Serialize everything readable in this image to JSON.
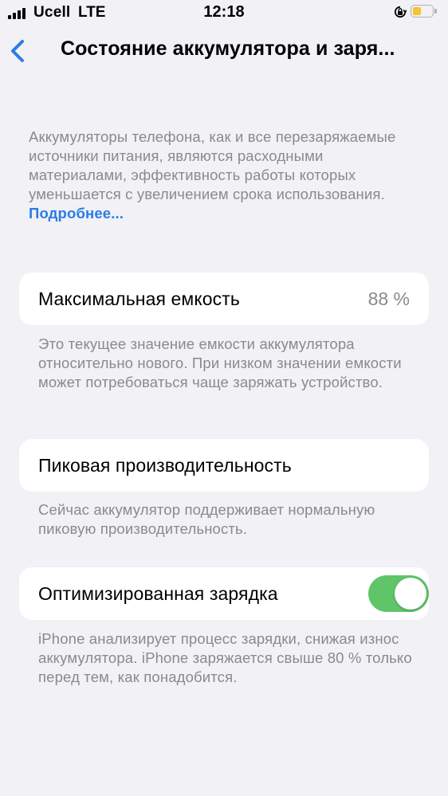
{
  "status_bar": {
    "carrier": "Ucell",
    "network": "LTE",
    "time": "12:18",
    "battery_color": "#f4c531"
  },
  "nav": {
    "back_icon": "chevron-left-icon",
    "title": "Состояние аккумулятора и заря..."
  },
  "intro": {
    "text": "Аккумуляторы телефона, как и все перезаряжаемые источники питания, являются расходными материалами, эффективность работы которых уменьшается с увеличением срока использования.",
    "link": "Подробнее..."
  },
  "max_capacity": {
    "label": "Максимальная емкость",
    "value": "88 %",
    "footnote": "Это текущее значение емкости аккумулятора относительно нового. При низком значении емкости может потребоваться чаще заряжать устройство."
  },
  "peak_performance": {
    "label": "Пиковая производительность",
    "footnote": "Сейчас аккумулятор поддерживает нормальную пиковую производительность."
  },
  "optimized_charging": {
    "label": "Оптимизированная зарядка",
    "enabled": true,
    "toggle_color": "#5fc568",
    "footnote": "iPhone анализирует процесс зарядки, снижая износ аккумулятора. iPhone заряжается свыше 80 % только перед тем, как понадобится."
  },
  "accent_color": "#2b7ce6"
}
